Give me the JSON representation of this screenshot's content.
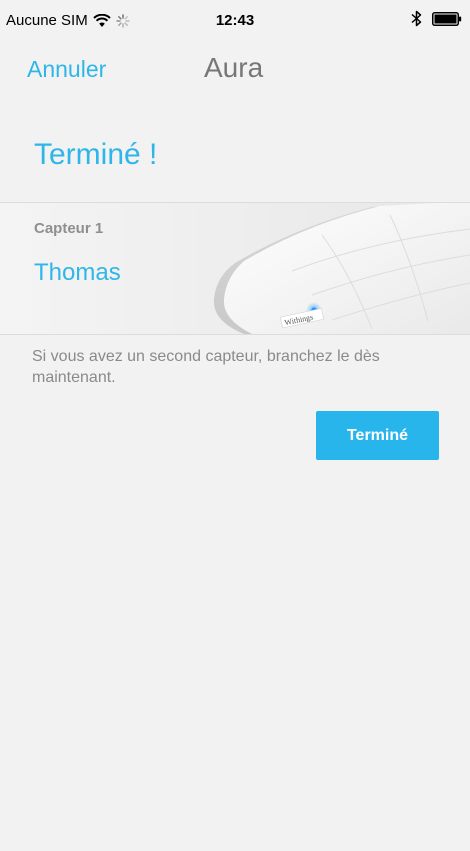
{
  "status_bar": {
    "carrier": "Aucune SIM",
    "time": "12:43",
    "icons": [
      "wifi-icon",
      "spinner-icon",
      "bluetooth-icon",
      "battery-icon"
    ]
  },
  "nav": {
    "cancel_label": "Annuler",
    "title": "Aura"
  },
  "heading": "Terminé !",
  "sensor": {
    "label": "Capteur 1",
    "name": "Thomas",
    "brand": "Withings"
  },
  "info": "Si vous avez un second capteur, branchez le dès maintenant.",
  "done_button": "Terminé",
  "colors": {
    "accent": "#2fb6e8",
    "button": "#27b5ec",
    "background": "#f2f2f2",
    "muted_text": "#8a8a8a"
  }
}
